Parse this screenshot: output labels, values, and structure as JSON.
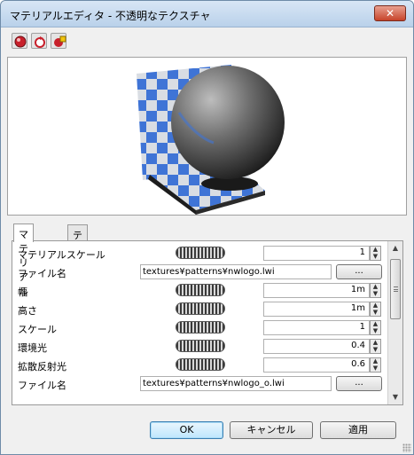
{
  "window": {
    "title": "マテリアルエディタ - 不透明なテクスチャ",
    "close_glyph": "✕"
  },
  "toolbar": {
    "buttons": [
      {
        "name": "render-sphere-icon"
      },
      {
        "name": "refresh-icon"
      },
      {
        "name": "settings-icon"
      }
    ]
  },
  "tabs": [
    {
      "label": "マテリアル",
      "active": true
    },
    {
      "label": "テクスチャ",
      "active": false
    }
  ],
  "rows": [
    {
      "label": "マテリアルスケール",
      "type": "number",
      "value": "1"
    },
    {
      "label": "ファイル名",
      "type": "file",
      "value": "textures¥patterns¥nwlogo.lwi",
      "button": "..."
    },
    {
      "label": "幅",
      "type": "number",
      "value": "1m"
    },
    {
      "label": "高さ",
      "type": "number",
      "value": "1m"
    },
    {
      "label": "スケール",
      "type": "number",
      "value": "1"
    },
    {
      "label": "環境光",
      "type": "number",
      "value": "0.4"
    },
    {
      "label": "拡散反射光",
      "type": "number",
      "value": "0.6"
    },
    {
      "label": "ファイル名",
      "type": "file",
      "value": "textures¥patterns¥nwlogo_o.lwi",
      "button": "..."
    }
  ],
  "scrollbar": {
    "up": "▲",
    "down": "▼"
  },
  "spinner": {
    "up": "▲",
    "down": "▼"
  },
  "buttons": {
    "ok": "OK",
    "cancel": "キャンセル",
    "apply": "適用"
  },
  "colors": {
    "checker_blue": "#3f74d6",
    "checker_light": "#d9dde3"
  }
}
